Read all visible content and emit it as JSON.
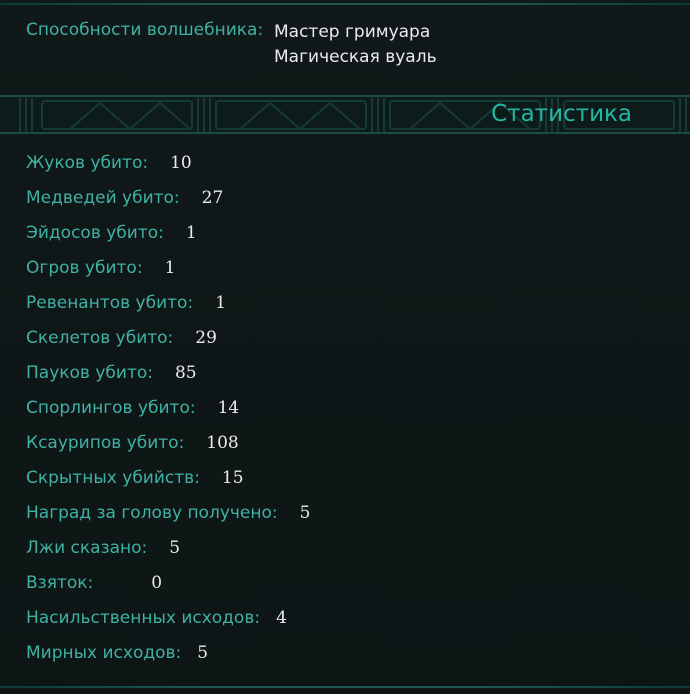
{
  "abilities": {
    "label": "Способности волшебника:",
    "values": [
      "Мастер гримуара",
      "Магическая вуаль"
    ]
  },
  "section": {
    "title": "Статистика"
  },
  "stats": [
    {
      "label": "Жуков убито:",
      "value": "10"
    },
    {
      "label": "Медведей убито:",
      "value": "27"
    },
    {
      "label": "Эйдосов убито:",
      "value": "1"
    },
    {
      "label": "Огров убито:",
      "value": "1"
    },
    {
      "label": "Ревенантов убито:",
      "value": "1"
    },
    {
      "label": "Скелетов убито:",
      "value": "29"
    },
    {
      "label": "Пауков убито:",
      "value": "85"
    },
    {
      "label": "Спорлингов убито:",
      "value": "14"
    },
    {
      "label": "Ксаурипов убито:",
      "value": "108"
    },
    {
      "label": "Скрытных убийств:",
      "value": "15"
    },
    {
      "label": "Наград за голову получено:",
      "value": "5"
    },
    {
      "label": "Лжи сказано:",
      "value": "5"
    },
    {
      "label": "Взяток:",
      "value": "0"
    },
    {
      "label": "Насильственных исходов:",
      "value": "4"
    },
    {
      "label": "Мирных исходов:",
      "value": "5"
    }
  ],
  "colors": {
    "background": "#0f1616",
    "label": "#3fb2a4",
    "value": "#e9ecec",
    "title": "#22b7a3",
    "ornament": "#1d4a45"
  }
}
